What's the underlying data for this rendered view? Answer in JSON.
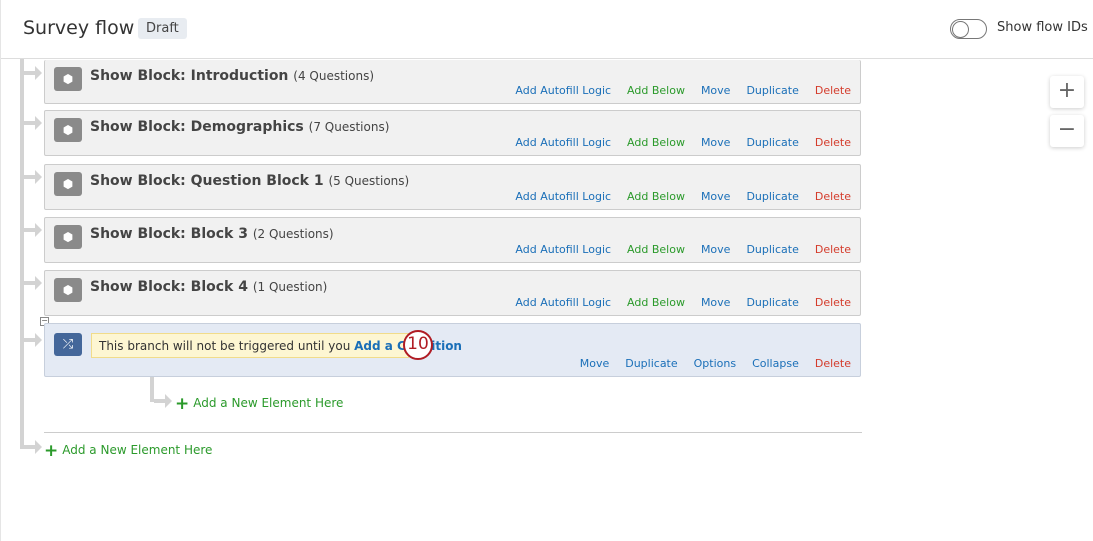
{
  "header": {
    "title": "Survey flow",
    "status": "Draft",
    "toggle_label": "Show flow IDs",
    "toggle_on": false
  },
  "zoom": {
    "in": "+",
    "out": "−"
  },
  "blocks": [
    {
      "title": "Show Block: Introduction",
      "count": "(4 Questions)"
    },
    {
      "title": "Show Block: Demographics",
      "count": "(7 Questions)"
    },
    {
      "title": "Show Block: Question Block 1",
      "count": "(5 Questions)"
    },
    {
      "title": "Show Block: Block 3",
      "count": "(2 Questions)"
    },
    {
      "title": "Show Block: Block 4",
      "count": "(1 Question)"
    }
  ],
  "block_actions": [
    "Add Autofill Logic",
    "Add Below",
    "Move",
    "Duplicate",
    "Delete"
  ],
  "branch": {
    "message": "This branch will not be triggered until you",
    "link": "Add a Condition",
    "actions": [
      "Move",
      "Duplicate",
      "Options",
      "Collapse",
      "Delete"
    ]
  },
  "annotation": "10",
  "add_element": "Add a New Element Here",
  "add_element_plus": "+",
  "colors": {
    "link": "#1a6fb8",
    "add": "#2b9a2b",
    "delete": "#d43b2b",
    "marker": "#b01c24"
  }
}
